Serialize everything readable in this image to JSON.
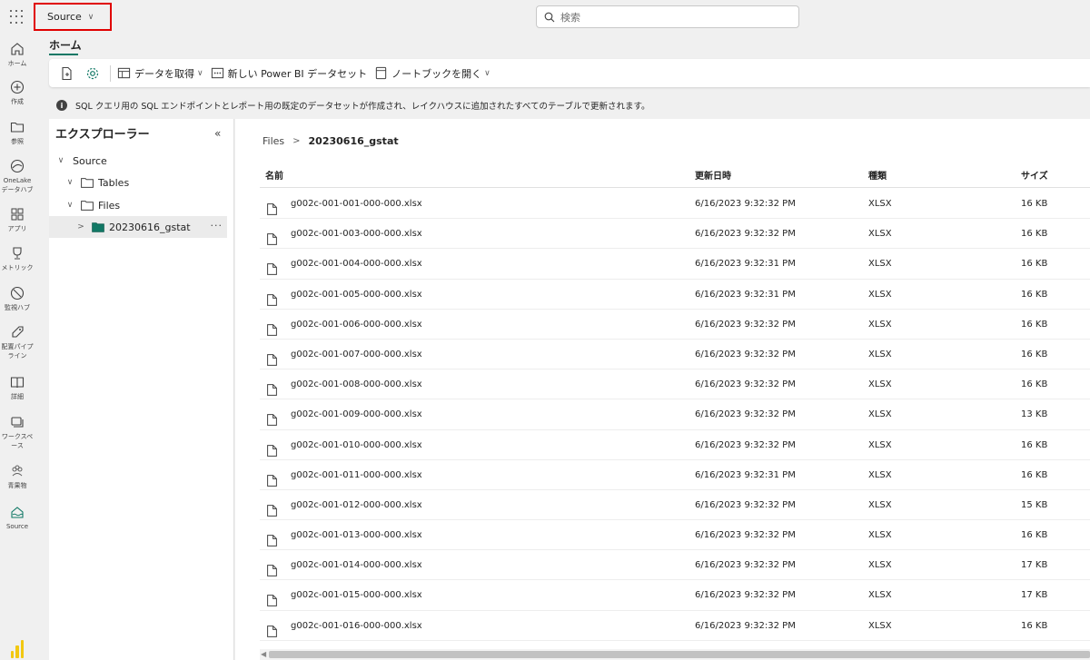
{
  "topbar": {
    "workspace_label": "Source",
    "search_placeholder": "検索"
  },
  "rail": {
    "items": [
      {
        "label": "ホーム",
        "icon": "home-icon"
      },
      {
        "label": "作成",
        "icon": "create-icon"
      },
      {
        "label": "参照",
        "icon": "browse-icon"
      },
      {
        "label": "OneLake データハブ",
        "icon": "onelake-icon"
      },
      {
        "label": "アプリ",
        "icon": "apps-icon"
      },
      {
        "label": "メトリック",
        "icon": "metrics-icon"
      },
      {
        "label": "監視ハブ",
        "icon": "monitor-icon"
      },
      {
        "label": "配置パイプライン",
        "icon": "pipeline-icon"
      },
      {
        "label": "詳細",
        "icon": "learn-icon"
      },
      {
        "label": "ワークスペース",
        "icon": "workspaces-icon"
      },
      {
        "label": "青果物",
        "icon": "workspace-avatar-icon"
      },
      {
        "label": "Source",
        "icon": "lakehouse-icon"
      }
    ]
  },
  "ribbon": {
    "tab": "ホーム",
    "get_data": "データを取得",
    "new_dataset": "新しい Power BI データセット",
    "open_notebook": "ノートブックを開く"
  },
  "info_message": "SQL クエリ用の SQL エンドポイントとレポート用の既定のデータセットが作成され、レイクハウスに追加されたすべてのテーブルで更新されます。",
  "explorer": {
    "title": "エクスプローラー",
    "tree": {
      "root": "Source",
      "tables": "Tables",
      "files": "Files",
      "selected_folder": "20230616_gstat"
    }
  },
  "breadcrumb": {
    "parent": "Files",
    "current": "20230616_gstat"
  },
  "table": {
    "columns": {
      "name": "名前",
      "modified": "更新日時",
      "type": "種類",
      "size": "サイズ"
    },
    "rows": [
      {
        "name": "g002c-001-001-000-000.xlsx",
        "modified": "6/16/2023 9:32:32 PM",
        "type": "XLSX",
        "size": "16 KB"
      },
      {
        "name": "g002c-001-003-000-000.xlsx",
        "modified": "6/16/2023 9:32:32 PM",
        "type": "XLSX",
        "size": "16 KB"
      },
      {
        "name": "g002c-001-004-000-000.xlsx",
        "modified": "6/16/2023 9:32:31 PM",
        "type": "XLSX",
        "size": "16 KB"
      },
      {
        "name": "g002c-001-005-000-000.xlsx",
        "modified": "6/16/2023 9:32:31 PM",
        "type": "XLSX",
        "size": "16 KB"
      },
      {
        "name": "g002c-001-006-000-000.xlsx",
        "modified": "6/16/2023 9:32:32 PM",
        "type": "XLSX",
        "size": "16 KB"
      },
      {
        "name": "g002c-001-007-000-000.xlsx",
        "modified": "6/16/2023 9:32:32 PM",
        "type": "XLSX",
        "size": "16 KB"
      },
      {
        "name": "g002c-001-008-000-000.xlsx",
        "modified": "6/16/2023 9:32:32 PM",
        "type": "XLSX",
        "size": "16 KB"
      },
      {
        "name": "g002c-001-009-000-000.xlsx",
        "modified": "6/16/2023 9:32:32 PM",
        "type": "XLSX",
        "size": "13 KB"
      },
      {
        "name": "g002c-001-010-000-000.xlsx",
        "modified": "6/16/2023 9:32:32 PM",
        "type": "XLSX",
        "size": "16 KB"
      },
      {
        "name": "g002c-001-011-000-000.xlsx",
        "modified": "6/16/2023 9:32:31 PM",
        "type": "XLSX",
        "size": "16 KB"
      },
      {
        "name": "g002c-001-012-000-000.xlsx",
        "modified": "6/16/2023 9:32:32 PM",
        "type": "XLSX",
        "size": "15 KB"
      },
      {
        "name": "g002c-001-013-000-000.xlsx",
        "modified": "6/16/2023 9:32:32 PM",
        "type": "XLSX",
        "size": "16 KB"
      },
      {
        "name": "g002c-001-014-000-000.xlsx",
        "modified": "6/16/2023 9:32:32 PM",
        "type": "XLSX",
        "size": "17 KB"
      },
      {
        "name": "g002c-001-015-000-000.xlsx",
        "modified": "6/16/2023 9:32:32 PM",
        "type": "XLSX",
        "size": "17 KB"
      },
      {
        "name": "g002c-001-016-000-000.xlsx",
        "modified": "6/16/2023 9:32:32 PM",
        "type": "XLSX",
        "size": "16 KB"
      }
    ]
  },
  "colors": {
    "accent": "#117865",
    "highlight_box": "#e00000",
    "folder": "#117865"
  }
}
